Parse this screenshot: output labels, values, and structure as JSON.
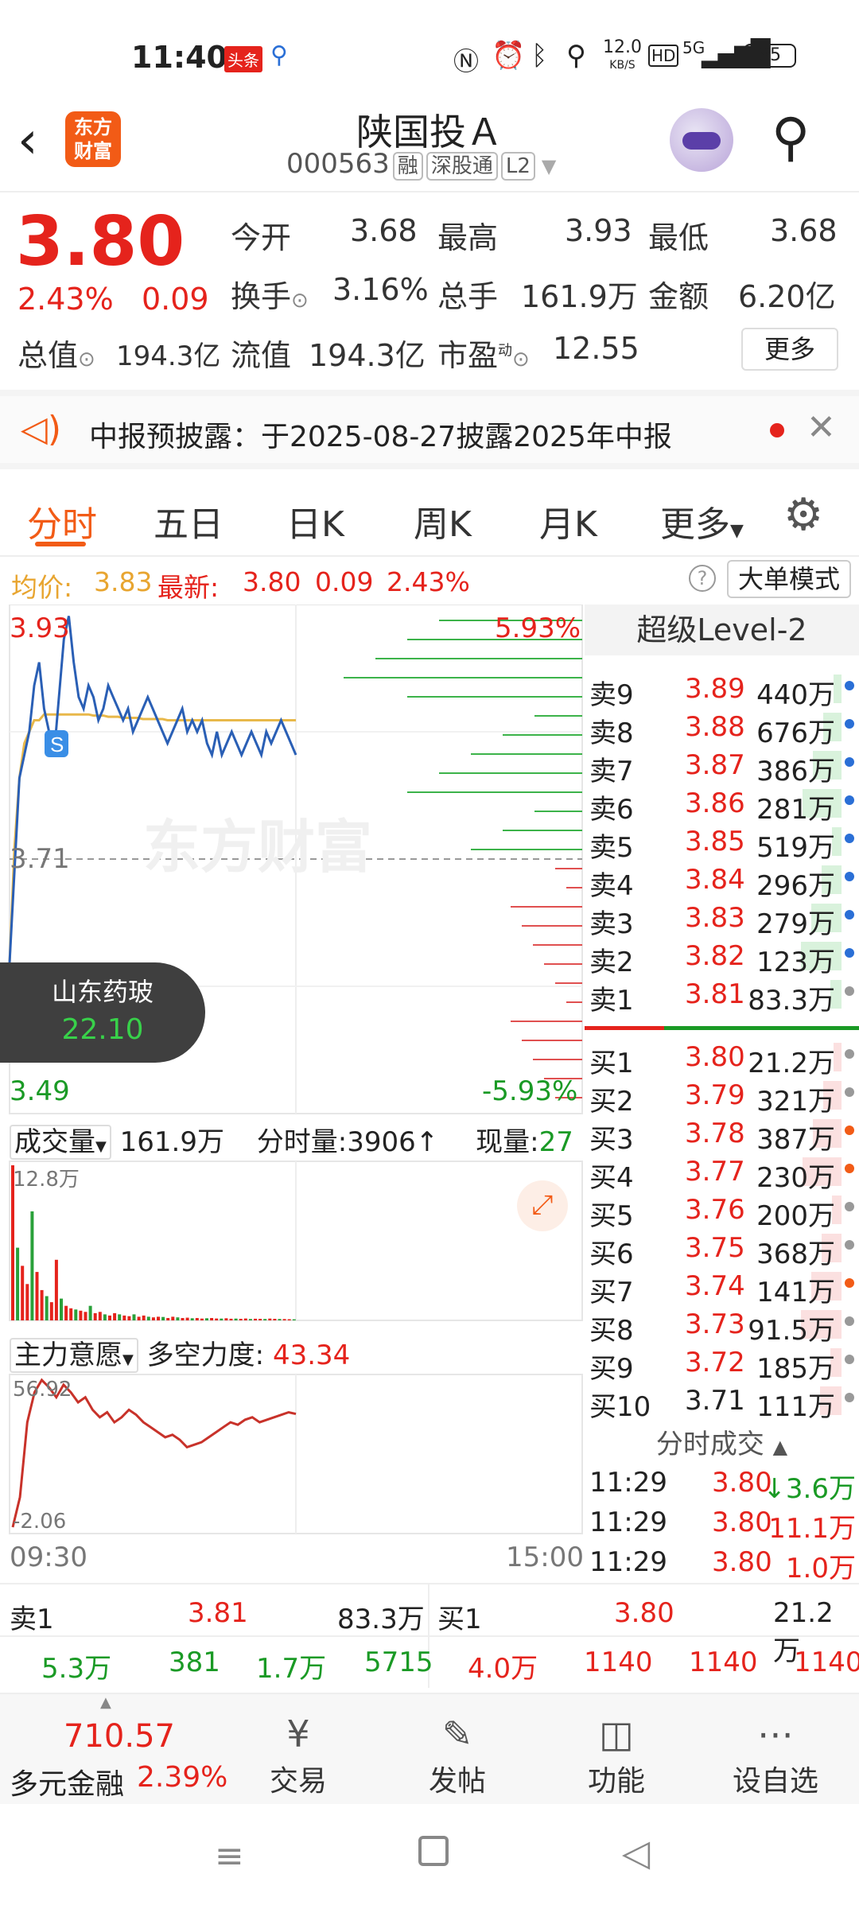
{
  "status": {
    "time": "11:40",
    "news_tag": "头条",
    "speed": "12.0",
    "speed_unit": "KB/S",
    "network": "5G",
    "battery": "85"
  },
  "header": {
    "brand_line1": "东方",
    "brand_line2": "财富",
    "title": "陕国投Ａ",
    "code": "000563",
    "tags": [
      "融",
      "深股通",
      "L2"
    ]
  },
  "quote": {
    "price": "3.80",
    "change_pct": "2.43%",
    "change": "0.09",
    "open_label": "今开",
    "open": "3.68",
    "high_label": "最高",
    "high": "3.93",
    "low_label": "最低",
    "low": "3.68",
    "turnover_label": "换手",
    "turnover": "3.16%",
    "volume_label": "总手",
    "volume": "161.9万",
    "amount_label": "金额",
    "amount": "6.20亿",
    "mktcap_label": "总值",
    "mktcap": "194.3亿",
    "float_label": "流值",
    "float": "194.3亿",
    "pe_label": "市盈",
    "pe_sup": "动",
    "pe": "12.55",
    "more": "更多"
  },
  "notice": {
    "text": "中报预披露：于2025-08-27披露2025年中报"
  },
  "tabs": [
    "分时",
    "五日",
    "日K",
    "周K",
    "月K",
    "更多"
  ],
  "infoline": {
    "avg_label": "均价:",
    "avg": "3.83",
    "latest_label": "最新:",
    "latest": "3.80",
    "change": "0.09",
    "pct": "2.43%",
    "mode": "大单模式"
  },
  "chart": {
    "top_price": "3.93",
    "top_pct": "5.93%",
    "mid_price": "3.71",
    "bottom_price": "3.49",
    "bottom_pct": "-5.93%",
    "watermark": "东方财富",
    "sector_name": "山东药玻",
    "sector_value": "22.10",
    "vol_label": "成交量",
    "vol_total": "161.9万",
    "vol_tick_label": "分时量:3906",
    "cur_vol_label": "现量:",
    "cur_vol": "27",
    "vol_max": "12.8万",
    "ind_label": "主力意愿",
    "ind_name": "多空力度:",
    "ind_value": "43.34",
    "ind_max": "56.92",
    "ind_min": "-2.06",
    "time_start": "09:30",
    "time_end": "15:00",
    "price_line": [
      3.62,
      3.7,
      3.78,
      3.8,
      3.82,
      3.86,
      3.88,
      3.84,
      3.82,
      3.8,
      3.85,
      3.9,
      3.92,
      3.88,
      3.85,
      3.84,
      3.86,
      3.85,
      3.83,
      3.84,
      3.86,
      3.85,
      3.84,
      3.83,
      3.84,
      3.82,
      3.83,
      3.84,
      3.85,
      3.84,
      3.83,
      3.82,
      3.81,
      3.82,
      3.83,
      3.84,
      3.82,
      3.83,
      3.82,
      3.83,
      3.81,
      3.8,
      3.82,
      3.8,
      3.81,
      3.82,
      3.81,
      3.8,
      3.81,
      3.82,
      3.81,
      3.8,
      3.82,
      3.81,
      3.82,
      3.83,
      3.82,
      3.81,
      3.8
    ],
    "avg_line": [
      3.62,
      3.72,
      3.78,
      3.81,
      3.82,
      3.83,
      3.83,
      3.835,
      3.835,
      3.835,
      3.835,
      3.835,
      3.835,
      3.835,
      3.835,
      3.835,
      3.835,
      3.834,
      3.834,
      3.834,
      3.833,
      3.833,
      3.833,
      3.832,
      3.832,
      3.832,
      3.832,
      3.831,
      3.831,
      3.831,
      3.831,
      3.831,
      3.83,
      3.83,
      3.83,
      3.83,
      3.83,
      3.83,
      3.83,
      3.83,
      3.83,
      3.83,
      3.83,
      3.83,
      3.83,
      3.83,
      3.83,
      3.83,
      3.83,
      3.83,
      3.83,
      3.83,
      3.83,
      3.83,
      3.83,
      3.83,
      3.83,
      3.83,
      3.83
    ],
    "ind_line": [
      -2.06,
      10,
      40,
      52,
      56.92,
      54,
      50,
      55,
      52,
      48,
      50,
      45,
      42,
      44,
      40,
      42,
      45,
      43,
      40,
      38,
      36,
      34,
      35,
      33,
      30,
      31,
      32,
      34,
      36,
      38,
      40,
      39,
      41,
      42,
      40,
      41,
      42,
      43,
      44,
      43.34
    ],
    "volumes": [
      128000,
      60000,
      45000,
      30000,
      90000,
      40000,
      25000,
      20000,
      15000,
      50000,
      18000,
      12000,
      10000,
      9000,
      8000,
      7000,
      12000,
      6000,
      7000,
      5000,
      4000,
      6000,
      5000,
      4000,
      3500,
      5000,
      3000,
      4000,
      3000,
      2500,
      3000,
      2800,
      2000,
      3000,
      2500,
      2000,
      2200,
      1800,
      2000,
      1500,
      1800,
      2000,
      1600,
      1500,
      1800,
      1400,
      1500,
      1300,
      1600,
      1200,
      1400,
      1300,
      1200,
      1500,
      1300,
      1200,
      1100,
      1000,
      900
    ]
  },
  "orderbook": {
    "title": "超级Level-2",
    "asks": [
      {
        "label": "卖9",
        "price": "3.89",
        "vol": "440万"
      },
      {
        "label": "卖8",
        "price": "3.88",
        "vol": "676万"
      },
      {
        "label": "卖7",
        "price": "3.87",
        "vol": "386万"
      },
      {
        "label": "卖6",
        "price": "3.86",
        "vol": "281万"
      },
      {
        "label": "卖5",
        "price": "3.85",
        "vol": "519万"
      },
      {
        "label": "卖4",
        "price": "3.84",
        "vol": "296万"
      },
      {
        "label": "卖3",
        "price": "3.83",
        "vol": "279万"
      },
      {
        "label": "卖2",
        "price": "3.82",
        "vol": "123万"
      },
      {
        "label": "卖1",
        "price": "3.81",
        "vol": "83.3万"
      }
    ],
    "bids": [
      {
        "label": "买1",
        "price": "3.80",
        "vol": "21.2万"
      },
      {
        "label": "买2",
        "price": "3.79",
        "vol": "321万"
      },
      {
        "label": "买3",
        "price": "3.78",
        "vol": "387万"
      },
      {
        "label": "买4",
        "price": "3.77",
        "vol": "230万"
      },
      {
        "label": "买5",
        "price": "3.76",
        "vol": "200万"
      },
      {
        "label": "买6",
        "price": "3.75",
        "vol": "368万"
      },
      {
        "label": "买7",
        "price": "3.74",
        "vol": "141万"
      },
      {
        "label": "买8",
        "price": "3.73",
        "vol": "91.5万"
      },
      {
        "label": "买9",
        "price": "3.72",
        "vol": "185万"
      },
      {
        "label": "买10",
        "price": "3.71",
        "vol": "111万"
      }
    ],
    "ticks_label": "分时成交",
    "ticks": [
      {
        "time": "11:29",
        "price": "3.80",
        "vol": "↓3.6万"
      },
      {
        "time": "11:29",
        "price": "3.80",
        "vol": "11.1万"
      },
      {
        "time": "11:29",
        "price": "3.80",
        "vol": "1.0万"
      }
    ]
  },
  "bottomquote": {
    "sell_label": "卖1",
    "sell_price": "3.81",
    "sell_vol": "83.3万",
    "buy_label": "买1",
    "buy_price": "3.80",
    "buy_vol": "21.2万",
    "left": [
      "5.3万",
      "381",
      "1.7万",
      "5715"
    ],
    "right": [
      "4.0万",
      "1140",
      "1140",
      "1140"
    ]
  },
  "nav": {
    "index_value": "710.57",
    "index_name": "多元金融",
    "index_pct": "2.39%",
    "items": [
      "交易",
      "发帖",
      "功能",
      "设自选"
    ]
  }
}
